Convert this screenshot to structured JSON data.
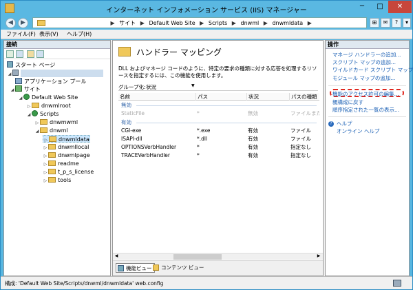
{
  "window": {
    "title": "インターネット インフォメーション サービス (IIS) マネージャー",
    "minimize": "─",
    "maximize": "□",
    "close": "✕"
  },
  "address": {
    "back": "◀",
    "forward": "▶",
    "crumbs": [
      "サイト",
      "Default Web Site",
      "Scripts",
      "dnwml",
      "dnwmldata"
    ],
    "separator": "▶"
  },
  "menu": {
    "file": "ファイル(F)",
    "view": "表示(V)",
    "help": "ヘルプ(H)"
  },
  "connections": {
    "header": "接続",
    "tree": [
      {
        "label": "スタート ページ",
        "icon": "start-page-icon"
      },
      {
        "label": "",
        "icon": "server-icon"
      },
      {
        "label": "アプリケーション プール",
        "icon": "app-pool-icon"
      },
      {
        "label": "サイト",
        "icon": "sites-icon"
      },
      {
        "label": "Default Web Site",
        "icon": "globe-icon"
      },
      {
        "label": "dnwmlroot",
        "icon": "folder-icon"
      },
      {
        "label": "Scripts",
        "icon": "globe-icon"
      },
      {
        "label": "dnwmwml",
        "icon": "folder-icon"
      },
      {
        "label": "dnwml",
        "icon": "folder-icon"
      },
      {
        "label": "dnwmldata",
        "icon": "folder-icon"
      },
      {
        "label": "dnwmllocal",
        "icon": "folder-icon"
      },
      {
        "label": "dnwmlpage",
        "icon": "folder-icon"
      },
      {
        "label": "readme",
        "icon": "folder-icon"
      },
      {
        "label": "t_p_s_license",
        "icon": "folder-icon"
      },
      {
        "label": "tools",
        "icon": "folder-icon"
      }
    ]
  },
  "center": {
    "title": "ハンドラー マッピング",
    "description": "DLL およびマネージ コードのように、特定の要求の種類に対する応答を処理するリソースを指定するには、この機能を使用します。",
    "group_label": "グループ化:",
    "group_value": "状況",
    "columns": [
      "名前",
      "パス",
      "状況",
      "パスの種類"
    ],
    "groups": [
      {
        "label": "無効",
        "rows": [
          [
            "StaticFile",
            "*",
            "無効",
            "ファイルまたは"
          ]
        ]
      },
      {
        "label": "有効",
        "rows": [
          [
            "CGI-exe",
            "*.exe",
            "有効",
            "ファイル"
          ],
          [
            "ISAPI-dll",
            "*.dll",
            "有効",
            "ファイル"
          ],
          [
            "OPTIONSVerbHandler",
            "*",
            "有効",
            "指定なし"
          ],
          [
            "TRACEVerbHandler",
            "*",
            "有効",
            "指定なし"
          ]
        ]
      }
    ],
    "tabs": {
      "features": "機能ビュー",
      "content": "コンテンツ ビュー"
    }
  },
  "actions": {
    "header": "操作",
    "items": [
      "マネージ ハンドラーの追加...",
      "スクリプト マップの追加...",
      "ワイルドカード スクリプト マップの追加...",
      "モジュール マップの追加...",
      "機能のアクセス許可の編集...",
      "親構成に戻す",
      "順序指定された一覧の表示..."
    ],
    "help_items": [
      "ヘルプ",
      "オンライン ヘルプ"
    ]
  },
  "status": {
    "text": "構成: 'Default Web Site/Scripts/dnwml/dnwmldata' web.config"
  }
}
